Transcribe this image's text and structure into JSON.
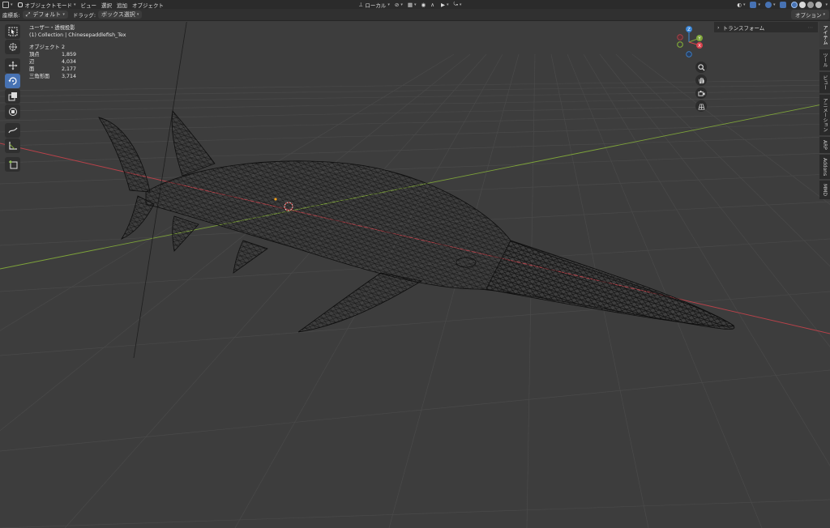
{
  "header": {
    "mode": "オブジェクトモード",
    "menus": [
      "ビュー",
      "選択",
      "追加",
      "オブジェクト"
    ],
    "transform_orientation": "ローカル"
  },
  "subheader": {
    "coordinates_label": "座標系:",
    "coordinates_value": "デフォルト",
    "drag_label": "ドラッグ:",
    "drag_value": "ボックス選択",
    "options_label": "オプション"
  },
  "overlay": {
    "view_name": "ユーザー・透視投影",
    "collection": "(1) Collection | Chinesepaddlefish_Tex",
    "stats": [
      {
        "label": "オブジェクト",
        "value": "2"
      },
      {
        "label": "頂点",
        "value": "1,859"
      },
      {
        "label": "辺",
        "value": "4,034"
      },
      {
        "label": "面",
        "value": "2,177"
      },
      {
        "label": "三角形面",
        "value": "3,714"
      }
    ]
  },
  "gizmo": {
    "x": "X",
    "y": "Y",
    "z": "Z"
  },
  "npanel": {
    "section": "トランスフォーム"
  },
  "sidebar_tabs": [
    "アイテム",
    "ツール",
    "ビュー",
    "アニメーション",
    "ARP",
    "Addons",
    "MMD"
  ],
  "colors": {
    "accent": "#4772b3",
    "x_axis": "#d6414b",
    "y_axis": "#7ea43a",
    "z_axis": "#3b86d6"
  }
}
